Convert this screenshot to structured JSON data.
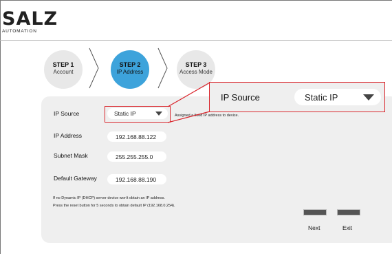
{
  "brand": {
    "name": "SALZ",
    "tagline": "AUTOMATION"
  },
  "steps": [
    {
      "title": "STEP 1",
      "subtitle": "Account"
    },
    {
      "title": "STEP 2",
      "subtitle": "IP Address"
    },
    {
      "title": "STEP 3",
      "subtitle": "Access Mode"
    }
  ],
  "form": {
    "ip_source_label": "IP Source",
    "ip_source_value": "Static IP",
    "ip_source_note": "Assigned a fixed IP address to device.",
    "ip_address_label": "IP Address",
    "ip_address_value": "192.168.88.122",
    "subnet_label": "Subnet Mask",
    "subnet_value": "255.255.255.0",
    "gateway_label": "Default Gateway",
    "gateway_value": "192.168.88.190"
  },
  "zoom": {
    "label": "IP Source",
    "value": "Static IP"
  },
  "help": {
    "line1": "If no Dynamic IP (DHCP) server device won't obtain an IP address.",
    "line2": "Press the reset button for 5 seconds to obtain default IP (192.168.0.254)."
  },
  "buttons": {
    "next": "Next",
    "exit": "Exit"
  },
  "colors": {
    "accent": "#3da3db",
    "highlight": "#d9232a",
    "panel": "#efefef"
  }
}
